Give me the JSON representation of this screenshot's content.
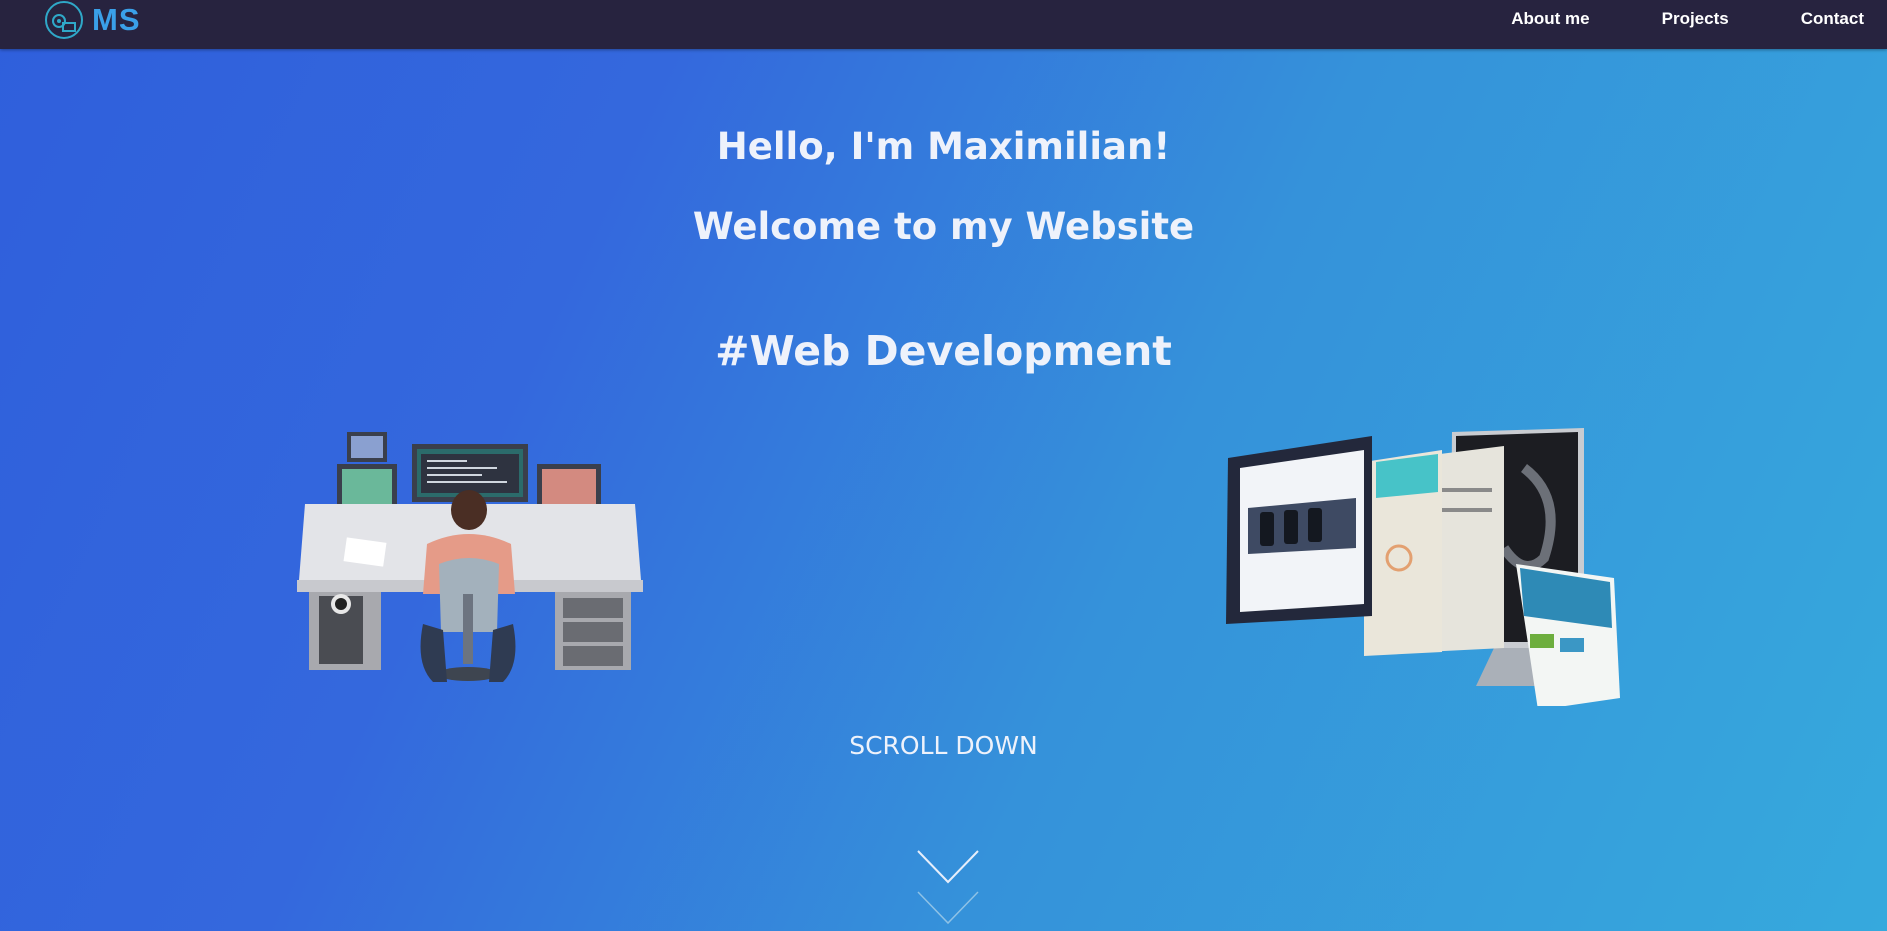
{
  "nav": {
    "logo_text": "MS",
    "links": [
      "About me",
      "Projects",
      "Contact"
    ]
  },
  "hero": {
    "greeting": "Hello, I'm Maximilian!",
    "welcome": "Welcome to my Website",
    "tagline": "#Web Development",
    "scroll_label": "SCROLL DOWN"
  },
  "colors": {
    "navbar": "#27233f",
    "logo_accent": "#3aa0e8",
    "gradient_start": "#2f5fdc",
    "gradient_end": "#36a9dd",
    "text": "#eef2fb"
  }
}
